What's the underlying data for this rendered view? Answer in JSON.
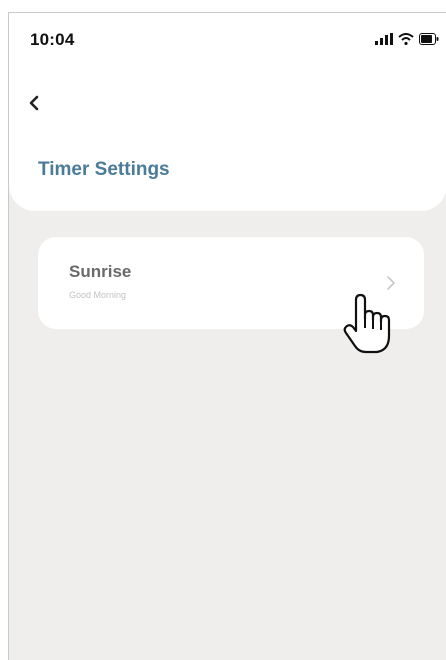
{
  "status_bar": {
    "time": "10:04",
    "icons": [
      "signal-icon",
      "wifi-icon",
      "battery-icon"
    ]
  },
  "header": {
    "back_icon": "chevron-left-icon",
    "title": "Timer Settings"
  },
  "timers": [
    {
      "title": "Sunrise",
      "subtitle": "Good Morning",
      "icon": "chevron-right-icon"
    }
  ],
  "colors": {
    "title_accent": "#4a7b98",
    "background": "#efeeec",
    "card": "#ffffff"
  },
  "overlay": {
    "cursor_icon": "hand-pointer-icon"
  }
}
